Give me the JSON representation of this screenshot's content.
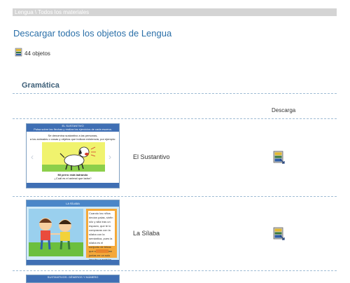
{
  "breadcrumb": "Lengua \\ Todos los materiales",
  "page_title": "Descargar todos los objetos de Lengua",
  "object_count": "44 objetos",
  "section_title": "Gramática",
  "table": {
    "download_header": "Descarga"
  },
  "items": [
    {
      "title": "El Sustantivo",
      "thumb_header": "EL SUSTANTIVO\nPulsa sobre las flechas y realiza los ejercicios de cada escena.",
      "thumb_text": "Se denomina sustantivo a las personas,\na los animales o cosas y objetos que indican existencia, por ejemplo:",
      "thumb_caption_bold": "Mi perro está ladrando",
      "thumb_caption": "¿Cuál es el animal que ladra?"
    },
    {
      "title": "La Sílaba",
      "thumb_header": "LA SÍLABA",
      "thumb_panel_text": "Cuando los niños decían palas, sinfín sílo y silla tras un espacio, que te lo compraras con la sílaba con la semántica, pues la sílaba es el conjunto de letras que se pronuncian juntas en un solo impulso a emisión de voz."
    },
    {
      "thumb_header": "SUSTANTIVOS: GÉNEROS Y NÚMERO"
    }
  ],
  "colors": {
    "title_blue": "#2a6fa8",
    "section_blue": "#3d5f78",
    "breadcrumb_bg": "#d4d4d4"
  }
}
